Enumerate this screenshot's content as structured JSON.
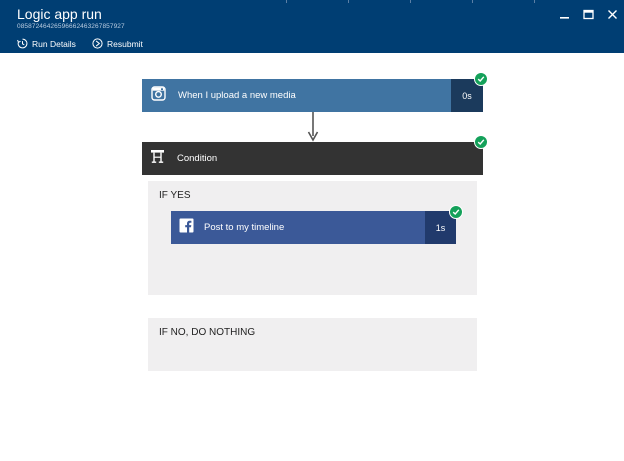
{
  "header": {
    "title": "Logic app run",
    "run_id": "08587246426596662463267857927",
    "commands": [
      {
        "label": "Run Details",
        "icon": "history-icon"
      },
      {
        "label": "Resubmit",
        "icon": "resubmit-icon"
      }
    ],
    "window_controls": [
      "minimize-icon",
      "maximize-icon",
      "close-icon"
    ],
    "background_color": "#003e73"
  },
  "workflow": {
    "trigger": {
      "label": "When I upload a new media",
      "duration": "0s",
      "icon": "instagram-icon",
      "status": "succeeded",
      "color": "#4074a2"
    },
    "condition": {
      "label": "Condition",
      "icon": "condition-icon",
      "status": "succeeded",
      "color": "#333333",
      "if_yes": {
        "label": "IF YES",
        "actions": [
          {
            "label": "Post to my timeline",
            "duration": "1s",
            "icon": "facebook-icon",
            "status": "succeeded",
            "color": "#3b5998"
          }
        ]
      },
      "if_no": {
        "label": "IF NO, DO NOTHING"
      }
    },
    "success_color": "#14a15a"
  }
}
